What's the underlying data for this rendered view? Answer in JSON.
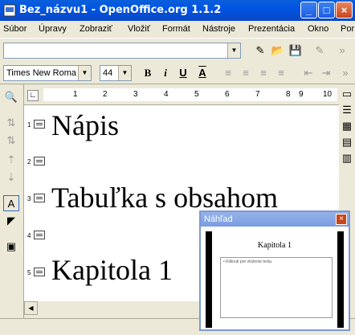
{
  "window": {
    "title": "Bez_názvu1 - OpenOffice.org 1.1.2"
  },
  "menu": [
    "Súbor",
    "Úpravy",
    "Zobraziť",
    "Vložiť",
    "Formát",
    "Nástroje",
    "Prezentácia",
    "Okno",
    "Por"
  ],
  "objectbar": {
    "font_name": "Times New Roma",
    "font_size": "44",
    "bold": "B",
    "italic": "i",
    "underline": "U",
    "shadow": "A"
  },
  "ruler": {
    "numbers": [
      "1",
      "2",
      "3",
      "4",
      "5",
      "6",
      "7",
      "8",
      "9",
      "10"
    ]
  },
  "outline": [
    {
      "num": "1",
      "text": "Nápis"
    },
    {
      "num": "2",
      "text": ""
    },
    {
      "num": "3",
      "text": "Tabuľka s obsahom"
    },
    {
      "num": "4",
      "text": ""
    },
    {
      "num": "5",
      "text": "Kapitola 1"
    }
  ],
  "preview": {
    "title": "Náhľad",
    "slide_title": "Kapitola 1",
    "slide_body": "• Kliknutí pre vloženie textu"
  }
}
